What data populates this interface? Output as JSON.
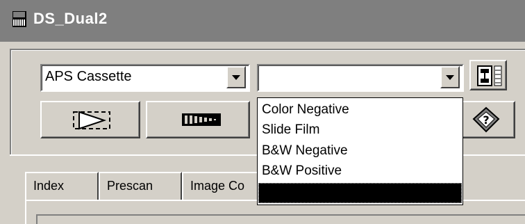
{
  "window": {
    "title": "DS_Dual2"
  },
  "controls": {
    "film_format": {
      "value": "APS Cassette"
    },
    "film_type": {
      "value": "",
      "options": [
        "Color Negative",
        "Slide Film",
        "B&W Negative",
        "B&W Positive",
        ""
      ],
      "selected_index": 4
    }
  },
  "toolbar": {
    "buttons": [
      "scan-forward-icon",
      "film-strip-icon",
      "help-book-icon",
      "film-adjust-icon"
    ]
  },
  "tabs": [
    {
      "label": "Index"
    },
    {
      "label": "Prescan"
    },
    {
      "label": "Image Co"
    }
  ],
  "colors": {
    "titlebar": "#7f7f7f",
    "face": "#d4d0c8",
    "selection": "#000000"
  }
}
